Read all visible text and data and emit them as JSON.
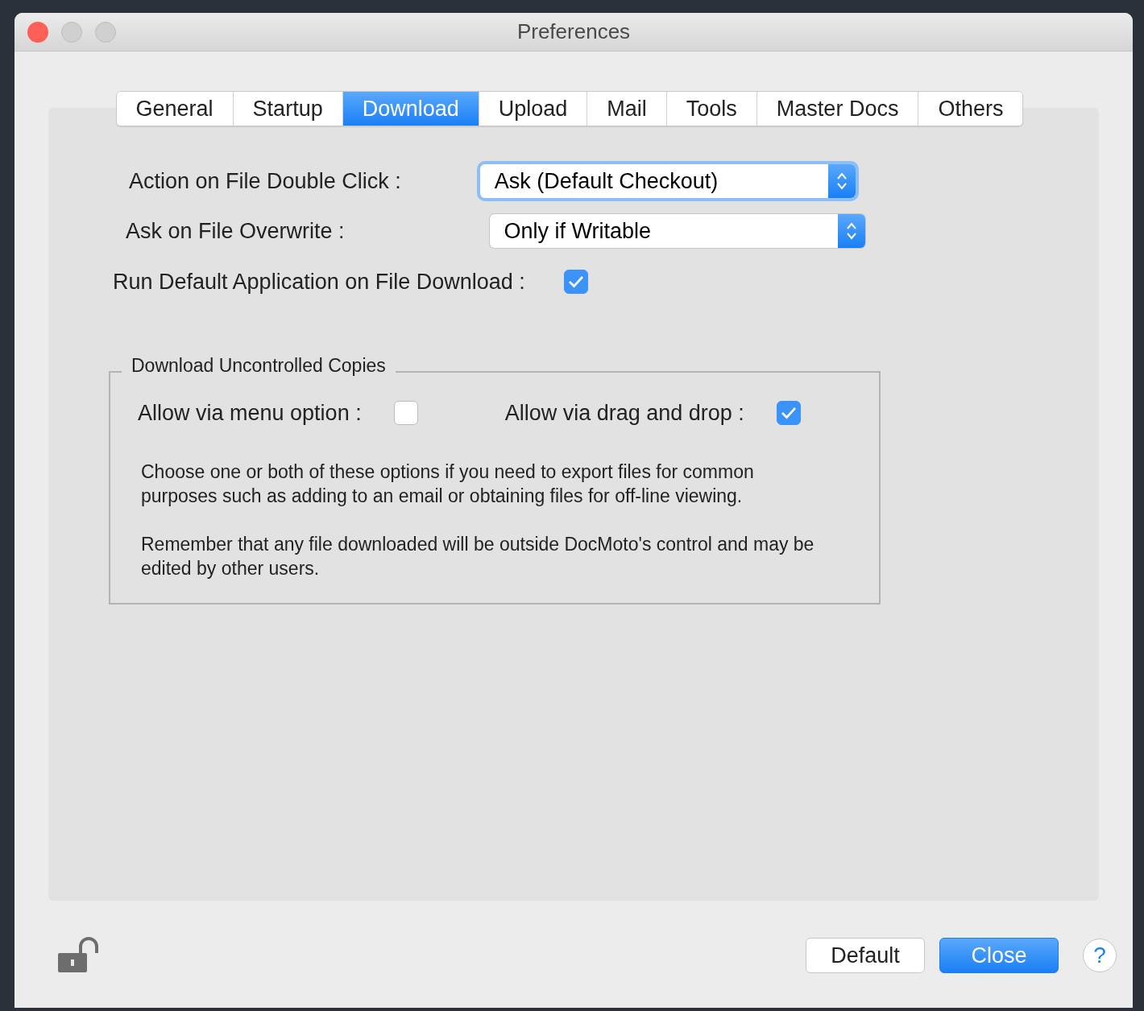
{
  "window": {
    "title": "Preferences"
  },
  "tabs": [
    {
      "label": "General",
      "selected": false
    },
    {
      "label": "Startup",
      "selected": false
    },
    {
      "label": "Download",
      "selected": true
    },
    {
      "label": "Upload",
      "selected": false
    },
    {
      "label": "Mail",
      "selected": false
    },
    {
      "label": "Tools",
      "selected": false
    },
    {
      "label": "Master Docs",
      "selected": false
    },
    {
      "label": "Others",
      "selected": false
    }
  ],
  "settings": [
    {
      "kind": "select",
      "label": "Action on File Double Click :",
      "value": "Ask (Default Checkout)",
      "focused": true
    },
    {
      "kind": "select",
      "label": "Ask on File Overwrite :",
      "value": "Only if Writable",
      "focused": false
    },
    {
      "kind": "checkbox",
      "label": "Run Default Application on File Download :",
      "checked": true
    }
  ],
  "group": {
    "title": "Download Uncontrolled Copies",
    "options": [
      {
        "label": "Allow via menu option :",
        "checked": false
      },
      {
        "label": "Allow via drag and drop :",
        "checked": true
      }
    ],
    "paragraphs": [
      "Choose one or both of these options if you need to export files for common purposes such as adding to an email or obtaining files for off-line viewing.",
      "Remember that any file downloaded will be outside DocMoto's control and may be edited by other users."
    ]
  },
  "footer": {
    "buttons": [
      {
        "label": "Default",
        "primary": false
      },
      {
        "label": "Close",
        "primary": true
      }
    ],
    "help": "?"
  }
}
